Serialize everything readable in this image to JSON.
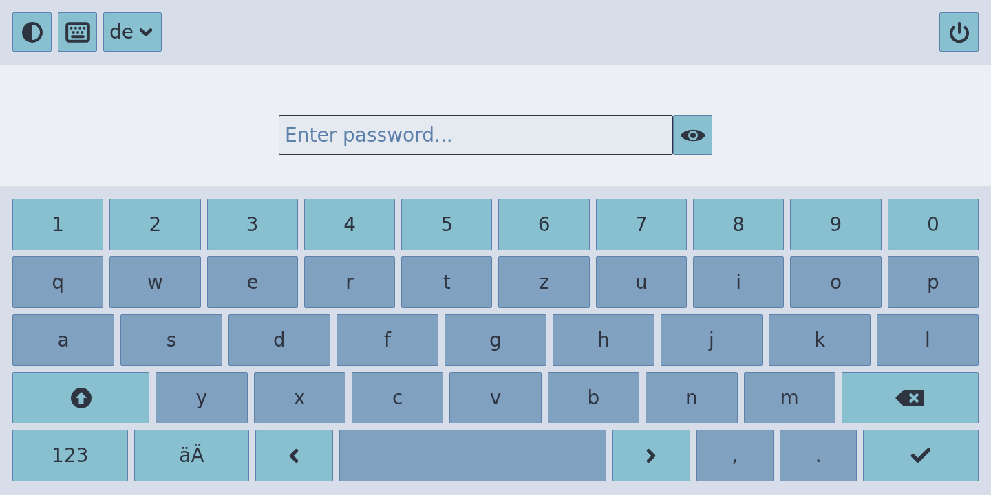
{
  "top_bar": {
    "language": {
      "value": "de"
    }
  },
  "password": {
    "placeholder": "Enter password..."
  },
  "keyboard": {
    "rows": [
      [
        {
          "kind": "digit",
          "label": "1"
        },
        {
          "kind": "digit",
          "label": "2"
        },
        {
          "kind": "digit",
          "label": "3"
        },
        {
          "kind": "digit",
          "label": "4"
        },
        {
          "kind": "digit",
          "label": "5"
        },
        {
          "kind": "digit",
          "label": "6"
        },
        {
          "kind": "digit",
          "label": "7"
        },
        {
          "kind": "digit",
          "label": "8"
        },
        {
          "kind": "digit",
          "label": "9"
        },
        {
          "kind": "digit",
          "label": "0"
        }
      ],
      [
        {
          "kind": "char",
          "label": "q"
        },
        {
          "kind": "char",
          "label": "w"
        },
        {
          "kind": "char",
          "label": "e"
        },
        {
          "kind": "char",
          "label": "r"
        },
        {
          "kind": "char",
          "label": "t"
        },
        {
          "kind": "char",
          "label": "z"
        },
        {
          "kind": "char",
          "label": "u"
        },
        {
          "kind": "char",
          "label": "i"
        },
        {
          "kind": "char",
          "label": "o"
        },
        {
          "kind": "char",
          "label": "p"
        }
      ],
      [
        {
          "kind": "char",
          "label": "a"
        },
        {
          "kind": "char",
          "label": "s"
        },
        {
          "kind": "char",
          "label": "d"
        },
        {
          "kind": "char",
          "label": "f"
        },
        {
          "kind": "char",
          "label": "g"
        },
        {
          "kind": "char",
          "label": "h"
        },
        {
          "kind": "char",
          "label": "j"
        },
        {
          "kind": "char",
          "label": "k"
        },
        {
          "kind": "char",
          "label": "l"
        }
      ],
      [
        {
          "kind": "shift"
        },
        {
          "kind": "char",
          "label": "y"
        },
        {
          "kind": "char",
          "label": "x"
        },
        {
          "kind": "char",
          "label": "c"
        },
        {
          "kind": "char",
          "label": "v"
        },
        {
          "kind": "char",
          "label": "b"
        },
        {
          "kind": "char",
          "label": "n"
        },
        {
          "kind": "char",
          "label": "m"
        },
        {
          "kind": "backspace"
        }
      ],
      [
        {
          "kind": "mode",
          "label": "123"
        },
        {
          "kind": "mode",
          "label": "äÄ"
        },
        {
          "kind": "left"
        },
        {
          "kind": "space"
        },
        {
          "kind": "right"
        },
        {
          "kind": "char",
          "label": ","
        },
        {
          "kind": "char",
          "label": "."
        },
        {
          "kind": "enter"
        }
      ]
    ]
  }
}
